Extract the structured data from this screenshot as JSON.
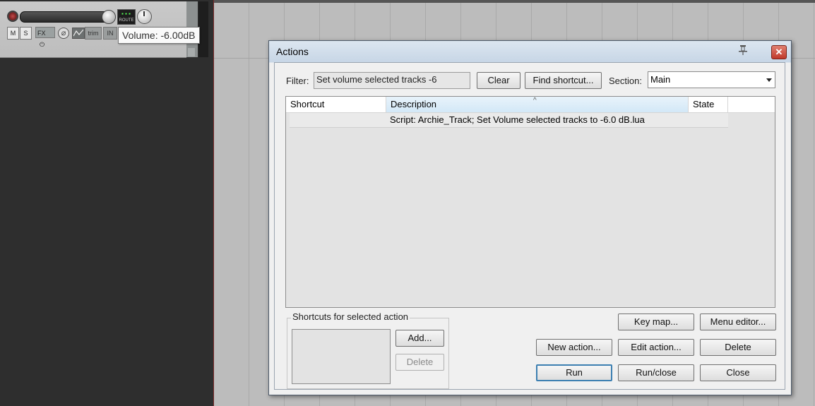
{
  "track": {
    "mute_label": "M",
    "solo_label": "S",
    "fx_label": "FX",
    "phase_glyph": "⌀",
    "trim_label": "trim",
    "in_label": "IN",
    "route_label": "ROUTE",
    "tooltip_text": "Volume: -6.00dB"
  },
  "dialog": {
    "title": "Actions",
    "filter_label": "Filter:",
    "filter_value": "Set volume selected tracks -6",
    "clear_label": "Clear",
    "find_shortcut_label": "Find shortcut...",
    "section_label": "Section:",
    "section_value": "Main",
    "close_glyph": "✕",
    "columns": {
      "shortcut": "Shortcut",
      "description": "Description",
      "state": "State"
    },
    "sort_glyph": "^",
    "rows": [
      {
        "shortcut": "",
        "description": "Script: Archie_Track; Set Volume selected tracks to -6.0 dB.lua",
        "state": ""
      }
    ],
    "shortcuts_group_title": "Shortcuts for selected action",
    "add_label": "Add...",
    "delete_shortcut_label": "Delete",
    "key_map_label": "Key map...",
    "menu_editor_label": "Menu editor...",
    "new_action_label": "New action...",
    "edit_action_label": "Edit action...",
    "delete_label": "Delete",
    "run_label": "Run",
    "run_close_label": "Run/close",
    "close_label": "Close"
  },
  "colors": {
    "arrange_bg": "#bcbcbc",
    "dark_bg": "#2e2e2e",
    "sorted_column": "#d3e8f7",
    "default_button_border": "#3c7fb1"
  }
}
